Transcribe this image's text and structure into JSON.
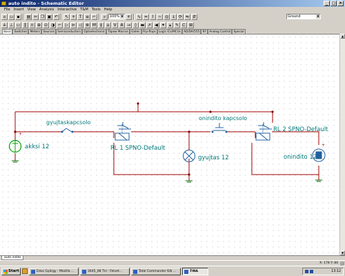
{
  "window": {
    "title": "auto indito - Schematic Editor"
  },
  "menu": [
    "File",
    "Insert",
    "View",
    "Analysis",
    "Interactive",
    "T&M",
    "Tools",
    "Help"
  ],
  "toolbar": {
    "zoom_value": "100%",
    "ground_select": "Ground"
  },
  "component_tabs": [
    {
      "label": "Basic",
      "active": true
    },
    {
      "label": "Switches"
    },
    {
      "label": "Meters"
    },
    {
      "label": "Sources"
    },
    {
      "label": "Semiconductors"
    },
    {
      "label": "Optoelectronic"
    },
    {
      "label": "Tapow Macros"
    },
    {
      "label": "Gates"
    },
    {
      "label": "Flip-flops"
    },
    {
      "label": "Logic ICs/MCUs"
    },
    {
      "label": "AD/DA/555"
    },
    {
      "label": "RF"
    },
    {
      "label": "Analog Control"
    },
    {
      "label": "Special"
    }
  ],
  "schematic": {
    "battery_label": "akksi 12",
    "switch1_label": "gyujtaskapcsolo",
    "relay1_label": "RL 1 SPNO-Default",
    "lamp_label": "gyujtas 12",
    "switch2_label": "onindito kapcsolo",
    "relay2_label": "RL 2 SPNO-Default",
    "motor_label": "onindito 12",
    "battery_plus": "+",
    "motor_plus": "+"
  },
  "sheet_tab": "auto indito",
  "status": {
    "coords": "X: 178  Y: 84"
  },
  "taskbar": {
    "start": "Start",
    "tasks": [
      {
        "label": "Edus György - Mozilla ..."
      },
      {
        "label": "3445_08 Tnl - Felvet..."
      },
      {
        "label": "Total Commander 6/b ..."
      },
      {
        "label": "TINA",
        "active": true
      }
    ],
    "clock": "13:12"
  },
  "colors": {
    "wire": "#a00000",
    "component": "#3070a0",
    "label": "#007878",
    "node": "#800000",
    "ground": "#006800"
  }
}
